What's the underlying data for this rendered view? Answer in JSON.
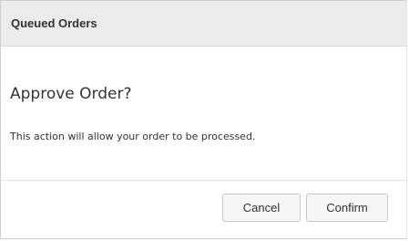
{
  "dialog": {
    "title": "Queued Orders",
    "heading": "Approve Order?",
    "message": "This action will allow your order to be processed."
  },
  "buttons": {
    "cancel_label": "Cancel",
    "confirm_label": "Confirm"
  }
}
